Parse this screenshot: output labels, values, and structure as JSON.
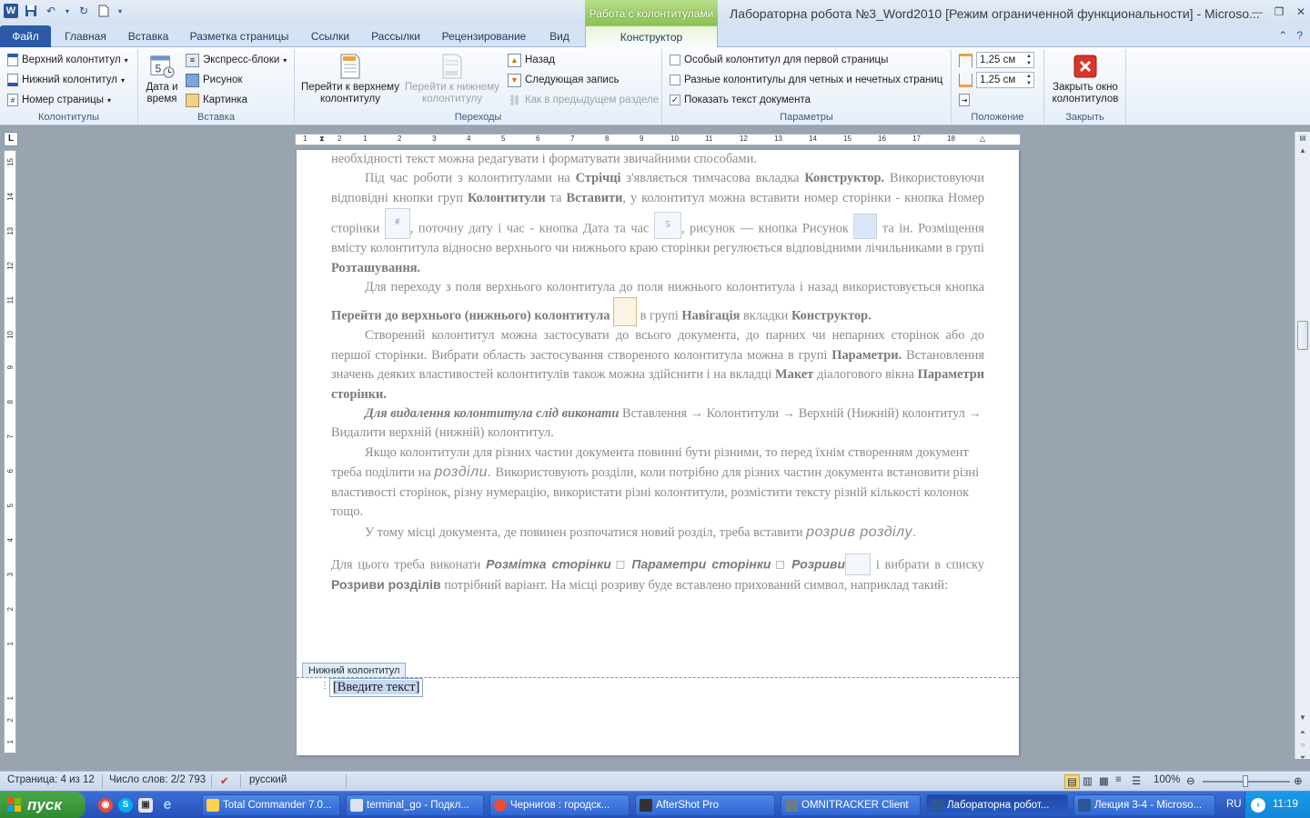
{
  "window": {
    "title": "Лабораторна робота №3_Word2010 [Режим ограниченной функциональности]  -  Microso...",
    "context_tab_title": "Работа с колонтитулами"
  },
  "tabs": [
    "Файл",
    "Главная",
    "Вставка",
    "Разметка страницы",
    "Ссылки",
    "Рассылки",
    "Рецензирование",
    "Вид",
    "Конструктор"
  ],
  "ribbon": {
    "headers_footers": {
      "label": "Колонтитулы",
      "header": "Верхний колонтитул",
      "footer": "Нижний колонтитул",
      "page_number": "Номер страницы"
    },
    "insert": {
      "label": "Вставка",
      "datetime_1": "Дата и",
      "datetime_2": "время",
      "quick_parts": "Экспресс-блоки",
      "picture": "Рисунок",
      "clipart": "Картинка"
    },
    "navigation": {
      "label": "Переходы",
      "goto_header_1": "Перейти к верхнему",
      "goto_header_2": "колонтитулу",
      "goto_footer_1": "Перейти к нижнему",
      "goto_footer_2": "колонтитулу",
      "previous": "Назад",
      "next": "Следующая запись",
      "link_previous": "Как в предыдущем разделе"
    },
    "options": {
      "label": "Параметры",
      "first_page": "Особый колонтитул для первой страницы",
      "odd_even": "Разные колонтитулы для четных и нечетных страниц",
      "show_text": "Показать текст документа",
      "first_page_checked": false,
      "odd_even_checked": false,
      "show_text_checked": true
    },
    "position": {
      "label": "Положение",
      "header_pos": "1,25 см",
      "footer_pos": "1,25 см"
    },
    "close": {
      "label": "Закрыть",
      "btn_1": "Закрыть окно",
      "btn_2": "колонтитулов"
    }
  },
  "ruler": {
    "h_marks": [
      "1",
      "2",
      "1",
      "1",
      "2",
      "3",
      "4",
      "5",
      "6",
      "7",
      "8",
      "9",
      "10",
      "11",
      "12",
      "13",
      "14",
      "15",
      "16",
      "17",
      "18"
    ],
    "v_marks": [
      "15",
      "14",
      "13",
      "12",
      "11",
      "10",
      "9",
      "8",
      "7",
      "6",
      "5",
      "4",
      "3",
      "2",
      "1",
      "1",
      "2",
      "1"
    ]
  },
  "document": {
    "p0": "необхідності текст можна редагувати і форматувати звичайними способами.",
    "p1_a": "Під час роботи з колонтитулами на ",
    "p1_b": "Стрічці",
    "p1_c": " з'являється тимчасова вкладка ",
    "p1_d": "Конструктор.",
    "p1_e": " Використовуючи відповідні кнопки груп ",
    "p1_f": "Колонтитули",
    "p1_g": " та ",
    "p1_h": "Вставити",
    "p1_i": ", у колонтитул можна вставити номер сторінки - кнопка Номер сторінки ",
    "p1_j": ", поточну дату і час - кнопка Дата та час ",
    "p1_k": ", рисунок — кнопка Рисунок ",
    "p1_l": " та ін. Розміщення вмісту колонтитула відносно верхнього чи нижнього краю сторінки регулюється відповідними лічильниками в групі ",
    "p1_m": "Розташування.",
    "p2_a": "Для переходу з поля верхнього колонтитула до поля нижнього колонтитула і назад використовується кнопка ",
    "p2_b": "Перейти до верхнього (нижнього) колонтитула",
    "p2_c": " в групі ",
    "p2_d": "Навігація",
    "p2_e": " вкладки ",
    "p2_f": "Конструктор.",
    "p3_a": "Створений колонтитул можна застосувати до всього документа, до парних чи непарних сторінок або до першої сторінки. Вибрати область застосування створеного колонтитула можна в групі ",
    "p3_b": "Параметри.",
    "p3_c": " Встановлення значень деяких властивостей колонтитулів також можна здійснити і на вкладці ",
    "p3_d": "Макет",
    "p3_e": " діалогового вікна ",
    "p3_f": "Параметри сторінки.",
    "p4_a": "Для видалення колонтитула слід виконати",
    "p4_b": " Вставлення → Колонтитули → Верхній (Нижній) колонтитул → Видалити верхній (нижній) колонтитул.",
    "p5_a": "Якщо колонтитули для різних частин документа повинні бути різними, то перед їхнім створенням документ треба поділити на ",
    "p5_b": "розділи.",
    "p5_c": " Використовують розділи, коли потрібно для різних частин документа встановити різні властивості сторінок, різну нумерацію, використати різні колонтитули, розмістити тексту різній кількості колонок тощо.",
    "p6_a": "У тому місці документа, де повинен розпочатися новий розділ, треба вставити ",
    "p6_b": "розрив розділу",
    "p6_c": ".",
    "p7_a": "Для цього треба виконати ",
    "p7_b": "Розмітка сторінки □ Параметри сторінки □ Розриви",
    "p7_c": " і вибрати в списку ",
    "p7_d": "Розриви розділів",
    "p7_e": " потрібний варіант. На місці розриву буде вставлено прихований символ, наприклад такий:",
    "icon_page_number": "#",
    "icon_date": "5"
  },
  "footer": {
    "tag": "Нижний колонтитул",
    "placeholder": "[Введите текст]"
  },
  "status": {
    "page": "Страница: 4 из 12",
    "words": "Число слов: 2/2 793",
    "lang": "русский",
    "zoom": "100%"
  },
  "taskbar": {
    "start": "пуск",
    "tasks": [
      "Total Commander 7.0...",
      "terminal_go - Подкл...",
      "Чернигов : городск...",
      "AfterShot Pro",
      "OMNITRACKER Client",
      "Лабораторна робот...",
      "Лекция 3-4 - Microso..."
    ],
    "lang": "RU",
    "time": "11:19"
  }
}
